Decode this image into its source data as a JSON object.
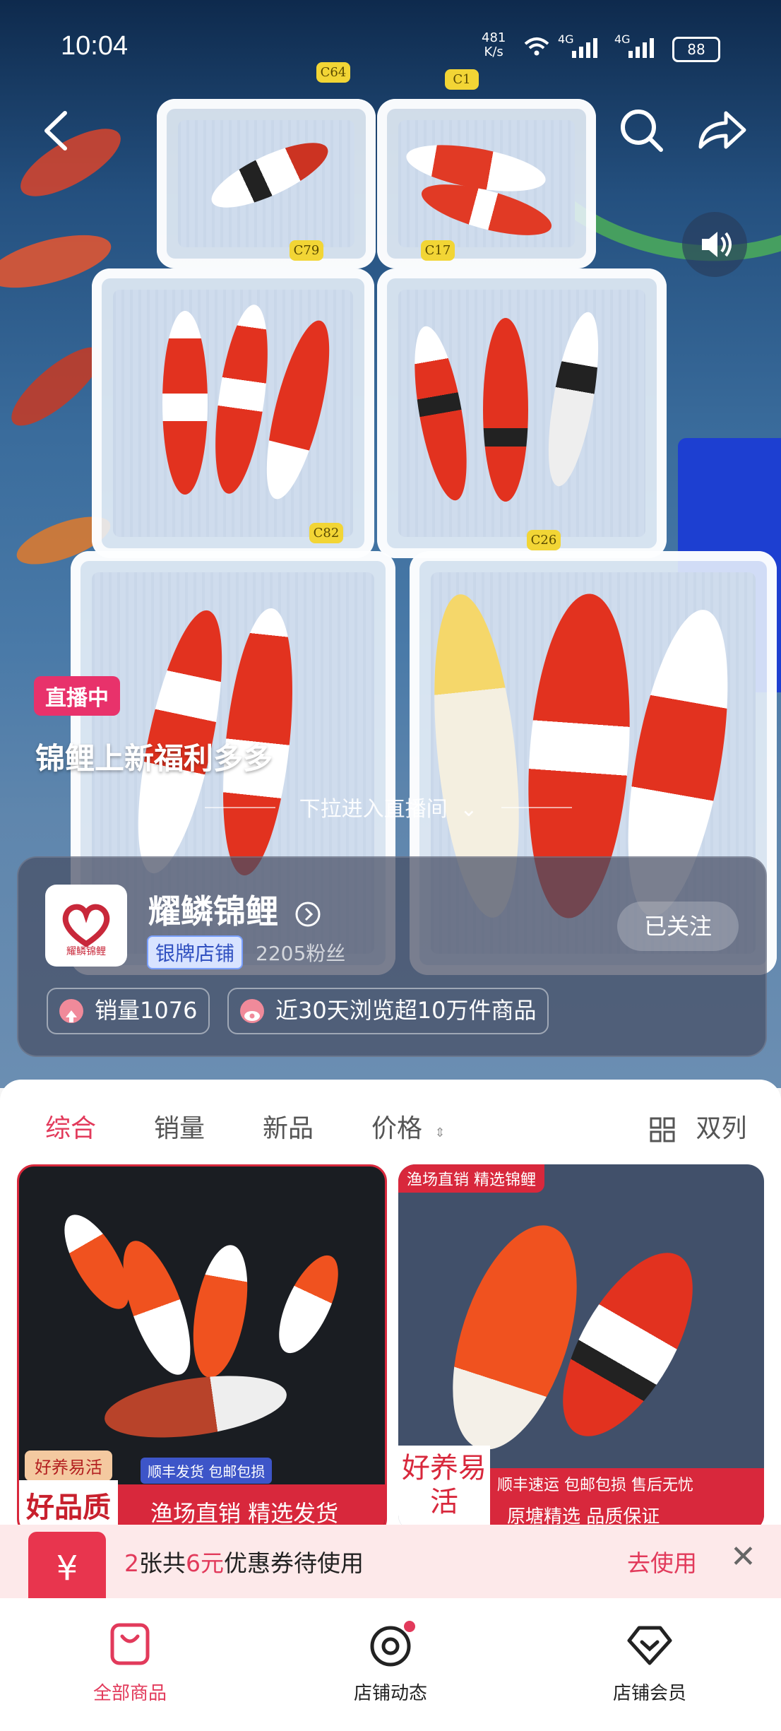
{
  "status_bar": {
    "time": "10:04",
    "net_speed_value": "481",
    "net_speed_unit": "K/s",
    "sig1": "4G",
    "sig2": "4G",
    "battery": "88"
  },
  "hero": {
    "basket_tags": [
      "C64",
      "C1",
      "C79",
      "C17",
      "C82",
      "C26"
    ],
    "live_badge": "直播中",
    "live_title": "锦鲤上新福利多多",
    "pull_hint": "下拉进入直播间",
    "nav_icons": {
      "back": "back-arrow-icon",
      "search": "search-icon",
      "share": "share-icon",
      "sound": "speaker-icon"
    }
  },
  "shop": {
    "logo_text": "耀鳞锦鲤",
    "name": "耀鳞锦鲤",
    "badge": "银牌店铺",
    "fans": "2205粉丝",
    "follow_label": "已关注",
    "stats": [
      "销量1076",
      "近30天浏览超10万件商品"
    ]
  },
  "tabs": [
    {
      "label": "综合",
      "active": true
    },
    {
      "label": "销量",
      "active": false
    },
    {
      "label": "新品",
      "active": false
    },
    {
      "label": "价格",
      "active": false
    }
  ],
  "layout_toggle": "双列",
  "products": [
    {
      "promo_tag": "好养易活",
      "shipping": "顺丰发货 包邮包损",
      "big_label": "好品质",
      "band_text": "渔场直销 精选发货"
    },
    {
      "top_tag": "渔场直销 精选锦鲤",
      "side_label": "好养易活",
      "line1": "顺丰速运 包邮包损 售后无忧",
      "line2": "原塘精选 品质保证"
    }
  ],
  "coupon": {
    "prefix": "2",
    "mid1": "张共",
    "amount": "6元",
    "suffix": "优惠券待使用",
    "use_label": "去使用",
    "yen": "¥"
  },
  "bottom_nav": [
    {
      "label": "全部商品",
      "icon": "shopping-bag-icon",
      "active": true
    },
    {
      "label": "店铺动态",
      "icon": "camera-icon",
      "active": false
    },
    {
      "label": "店铺会员",
      "icon": "member-heart-icon",
      "active": false
    }
  ],
  "colors": {
    "accent": "#e23a5b",
    "live_badge": "#e8326b",
    "silver_badge": "#3050c0"
  }
}
